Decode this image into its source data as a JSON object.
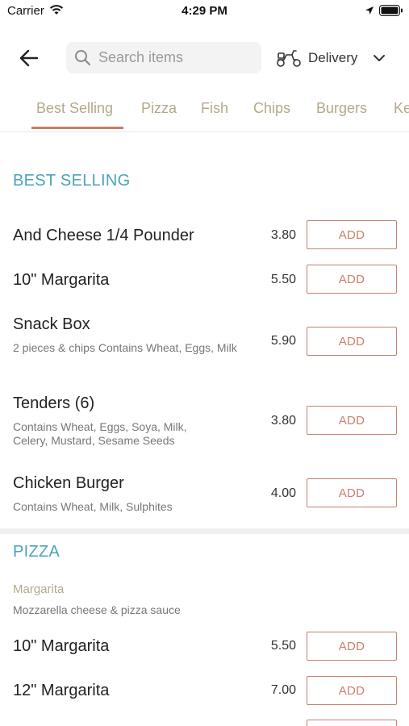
{
  "status_bar": {
    "carrier": "Carrier",
    "time": "4:29 PM"
  },
  "header": {
    "search_placeholder": "Search items",
    "delivery_label": "Delivery"
  },
  "tabs": [
    {
      "label": "Best Selling"
    },
    {
      "label": "Pizza"
    },
    {
      "label": "Fish"
    },
    {
      "label": "Chips"
    },
    {
      "label": "Burgers"
    },
    {
      "label": "Ke"
    }
  ],
  "sections": {
    "best_selling": {
      "title": "BEST SELLING",
      "items": [
        {
          "name": "And Cheese 1/4 Pounder",
          "description": "",
          "price": "3.80",
          "button": "ADD"
        },
        {
          "name": "10\" Margarita",
          "description": "",
          "price": "5.50",
          "button": "ADD"
        },
        {
          "name": "Snack Box",
          "description": "2 pieces & chips Contains Wheat, Eggs, Milk",
          "price": "5.90",
          "button": "ADD"
        },
        {
          "name": "Tenders (6)",
          "description": "Contains Wheat, Eggs, Soya, Milk, Celery, Mustard, Sesame Seeds",
          "price": "3.80",
          "button": "ADD"
        },
        {
          "name": "Chicken Burger",
          "description": "Contains Wheat, Milk, Sulphites",
          "price": "4.00",
          "button": "ADD"
        }
      ]
    },
    "pizza": {
      "title": "PIZZA",
      "subcategory": {
        "name": "Margarita",
        "description": "Mozzarella cheese & pizza sauce"
      },
      "items": [
        {
          "name": "10\" Margarita",
          "price": "5.50",
          "button": "ADD"
        },
        {
          "name": "12\" Margarita",
          "price": "7.00",
          "button": "ADD"
        }
      ]
    }
  },
  "colors": {
    "accent_teal": "#4ba3b9",
    "accent_red": "#c9806e",
    "tab_text": "#b3a98a"
  },
  "icons": {
    "back": "arrow-left-icon",
    "search": "search-icon",
    "delivery": "scooter-icon",
    "dropdown": "chevron-down-icon"
  }
}
